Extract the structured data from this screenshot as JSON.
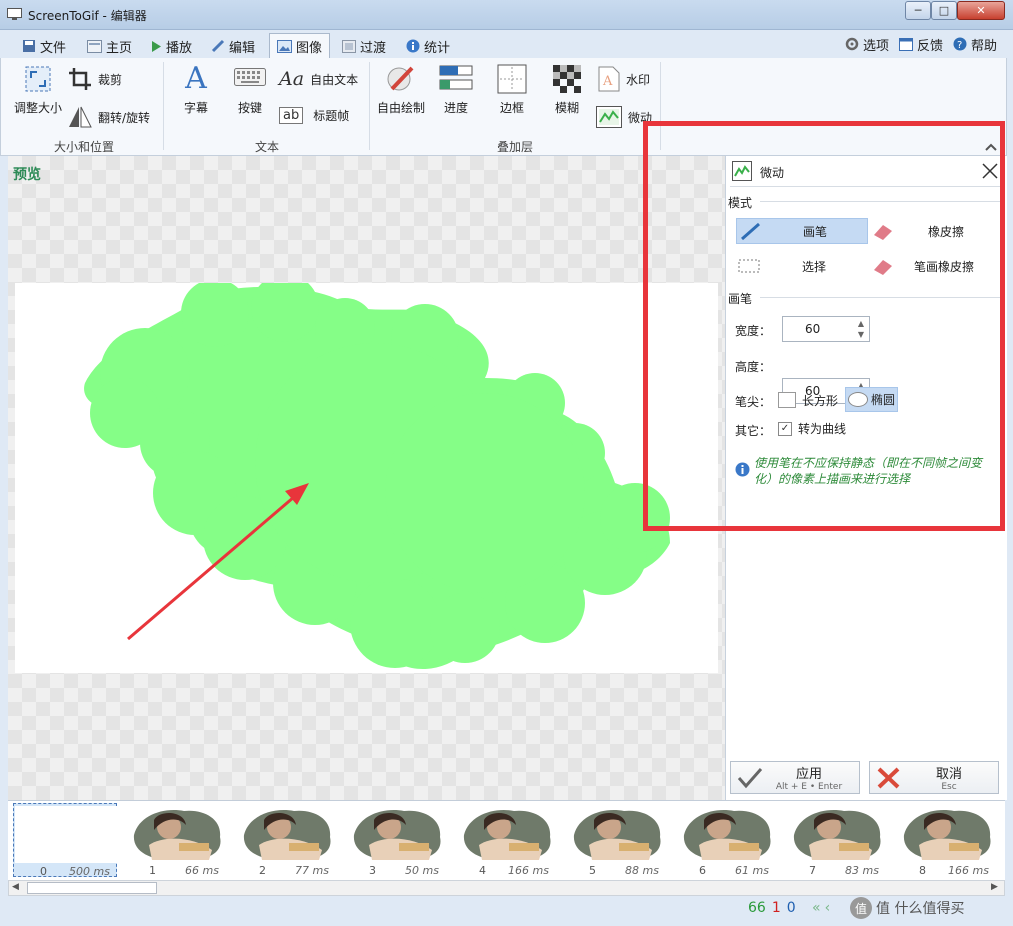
{
  "window": {
    "title": "ScreenToGif - 编辑器",
    "min": "─",
    "max": "□",
    "close": "✕"
  },
  "tabs": [
    {
      "label": "文件"
    },
    {
      "label": "主页"
    },
    {
      "label": "播放"
    },
    {
      "label": "编辑"
    },
    {
      "label": "图像"
    },
    {
      "label": "过渡"
    },
    {
      "label": "统计"
    }
  ],
  "top_right": {
    "options": "选项",
    "feedback": "反馈",
    "help": "帮助"
  },
  "ribbon": {
    "size_group": {
      "label": "大小和位置",
      "resize": "调整大小",
      "crop": "裁剪",
      "flip": "翻转/旋转"
    },
    "text_group": {
      "label": "文本",
      "caption": "字幕",
      "keys": "按键",
      "free_text": "自由文本",
      "title_frame": "标题帧"
    },
    "overlay_group": {
      "label": "叠加层",
      "free_draw": "自由绘制",
      "progress": "进度",
      "border": "边框",
      "blur": "模糊",
      "watermark": "水印",
      "cinemagraph": "微动"
    }
  },
  "preview": {
    "label": "预览"
  },
  "panel": {
    "title": "微动",
    "mode_label": "模式",
    "pen": "画笔",
    "eraser": "橡皮擦",
    "select": "选择",
    "stroke_eraser": "笔画橡皮擦",
    "brush_label": "画笔",
    "width_label": "宽度：",
    "width_value": "60",
    "height_label": "高度：",
    "height_value": "60",
    "tip_label": "笔尖：",
    "tip_rect": "长方形",
    "tip_ellipse": "椭圆",
    "other_label": "其它：",
    "curve": "转为曲线",
    "info": "使用笔在不应保持静态（即在不同帧之间变化）的像素上描画来进行选择",
    "apply": "应用",
    "apply_shortcut": "Alt + E • Enter",
    "cancel": "取消",
    "cancel_shortcut": "Esc"
  },
  "frames": [
    {
      "index": "0",
      "delay": "500 ms"
    },
    {
      "index": "1",
      "delay": "66 ms"
    },
    {
      "index": "2",
      "delay": "77 ms"
    },
    {
      "index": "3",
      "delay": "50 ms"
    },
    {
      "index": "4",
      "delay": "166 ms"
    },
    {
      "index": "5",
      "delay": "88 ms"
    },
    {
      "index": "6",
      "delay": "61 ms"
    },
    {
      "index": "7",
      "delay": "83 ms"
    },
    {
      "index": "8",
      "delay": "166 ms"
    }
  ],
  "status": {
    "total": "66",
    "selected": "1",
    "current": "0",
    "watermark": "值 什么值得买"
  },
  "colors": {
    "accent": "#2e6db5",
    "brush": "#85fe87",
    "annotation": "#e8353b",
    "total_color": "#2a9a3a",
    "selected_color": "#d02020",
    "current_color": "#1f5fb0"
  }
}
